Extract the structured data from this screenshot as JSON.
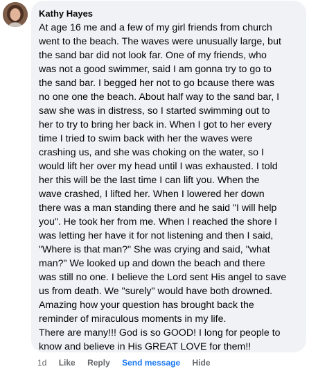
{
  "comment": {
    "author": "Kathy Hayes",
    "lines": [
      "At age 16 me and a few of my girl friends from church",
      "went to the beach. The waves were unusually large, but",
      "the sand bar did not look far. One of my friends, who",
      "was not a good swimmer, said I am gonna try to go to",
      "the sand bar. I begged her not to go bcause there was",
      "no one one the beach. About half way to the sand bar, I",
      "saw she was in distress, so I started swimming out to",
      "her to try to bring her back in. When I got to her every",
      "time I tried to swim back with her the waves were",
      "crashing us, and she was choking on the water, so I",
      "would lift her over my head until I was exhausted. I told",
      "her this will be the last time I can lift you. When the",
      "wave crashed, I lifted her. When I lowered her down",
      "there was a man standing there and he said \"I will help",
      "you\". He took her from me. When I reached the shore I",
      "was letting her have it for not listening and then I said,",
      "\"Where is that man?\" She was crying and said, \"what",
      "man?\" We looked up and down the beach and there",
      "was still no one. I believe the Lord sent His angel to save",
      "us from death. We \"surely\" would have both drowned.",
      "Amazing how your question has brought back the",
      "reminder of miraculous moments in my life.",
      "There are many!!! God is so GOOD! I long for people to",
      "know and believe in His GREAT LOVE for them!!"
    ]
  },
  "actions": {
    "time": "1d",
    "like": "Like",
    "reply": "Reply",
    "send_message": "Send message",
    "hide": "Hide"
  },
  "colors": {
    "bubble": "#f0f2f5",
    "text": "#050505",
    "meta": "#65676b",
    "link": "#1877f2"
  },
  "icons": {
    "avatar": "profile-photo"
  }
}
